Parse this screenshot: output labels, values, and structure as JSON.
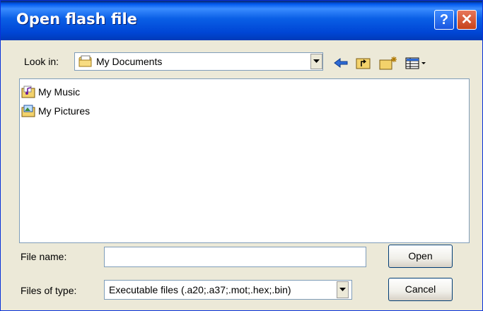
{
  "window": {
    "title": "Open flash file",
    "help_icon_text": "?",
    "close_icon_text": "✕"
  },
  "look_in": {
    "label": "Look in:",
    "value": "My Documents"
  },
  "toolbar": {
    "icons": [
      "back-arrow-icon",
      "up-folder-icon",
      "new-folder-icon",
      "view-menu-icon"
    ]
  },
  "files": [
    {
      "name": "My Music",
      "icon": "music-folder-icon"
    },
    {
      "name": "My Pictures",
      "icon": "pictures-folder-icon"
    }
  ],
  "file_name": {
    "label": "File name:",
    "value": ""
  },
  "files_of_type": {
    "label": "Files of type:",
    "value": "Executable files (.a20;.a37;.mot;.hex;.bin)"
  },
  "buttons": {
    "open": "Open",
    "cancel": "Cancel"
  },
  "colors": {
    "titlebar": "#0054e3",
    "dialog_bg": "#ece9d8",
    "close": "#d6532c"
  }
}
